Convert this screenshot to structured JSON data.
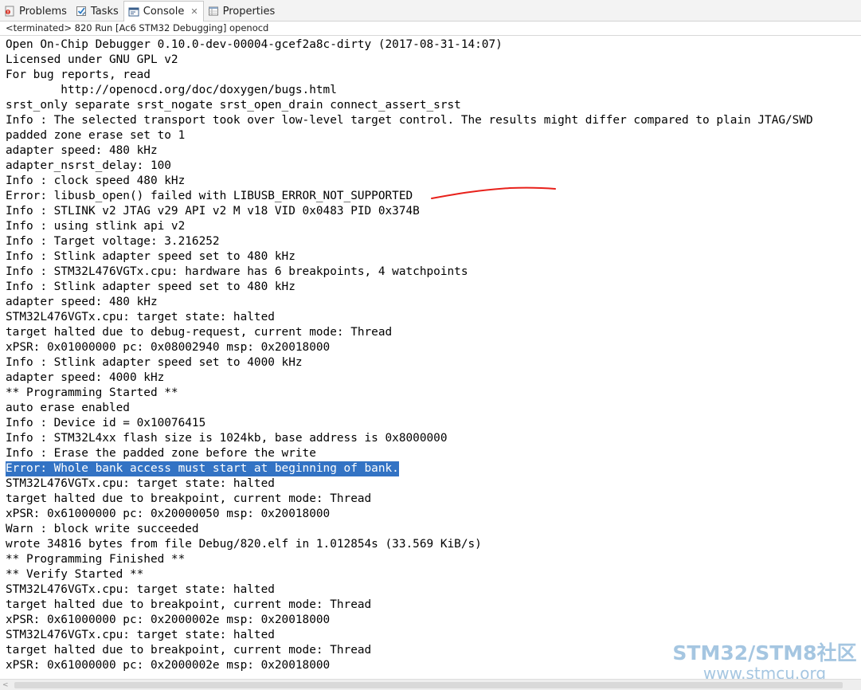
{
  "tabs": [
    {
      "label": "Problems",
      "icon": "problems-icon"
    },
    {
      "label": "Tasks",
      "icon": "tasks-icon"
    },
    {
      "label": "Console",
      "icon": "console-icon",
      "active": true
    },
    {
      "label": "Properties",
      "icon": "properties-icon"
    }
  ],
  "status": "<terminated> 820 Run [Ac6 STM32 Debugging] openocd",
  "console": {
    "lines": [
      "Open On-Chip Debugger 0.10.0-dev-00004-gcef2a8c-dirty (2017-08-31-14:07)",
      "Licensed under GNU GPL v2",
      "For bug reports, read",
      "        http://openocd.org/doc/doxygen/bugs.html",
      "srst_only separate srst_nogate srst_open_drain connect_assert_srst",
      "Info : The selected transport took over low-level target control. The results might differ compared to plain JTAG/SWD",
      "padded zone erase set to 1",
      "adapter speed: 480 kHz",
      "adapter_nsrst_delay: 100",
      "Info : clock speed 480 kHz",
      "Error: libusb_open() failed with LIBUSB_ERROR_NOT_SUPPORTED",
      "Info : STLINK v2 JTAG v29 API v2 M v18 VID 0x0483 PID 0x374B",
      "Info : using stlink api v2",
      "Info : Target voltage: 3.216252",
      "Info : Stlink adapter speed set to 480 kHz",
      "Info : STM32L476VGTx.cpu: hardware has 6 breakpoints, 4 watchpoints",
      "Info : Stlink adapter speed set to 480 kHz",
      "adapter speed: 480 kHz",
      "STM32L476VGTx.cpu: target state: halted",
      "target halted due to debug-request, current mode: Thread",
      "xPSR: 0x01000000 pc: 0x08002940 msp: 0x20018000",
      "Info : Stlink adapter speed set to 4000 kHz",
      "adapter speed: 4000 kHz",
      "** Programming Started **",
      "auto erase enabled",
      "Info : Device id = 0x10076415",
      "Info : STM32L4xx flash size is 1024kb, base address is 0x8000000",
      "Info : Erase the padded zone before the write",
      "Error: Whole bank access must start at beginning of bank.",
      "STM32L476VGTx.cpu: target state: halted",
      "target halted due to breakpoint, current mode: Thread",
      "xPSR: 0x61000000 pc: 0x20000050 msp: 0x20018000",
      "Warn : block write succeeded",
      "wrote 34816 bytes from file Debug/820.elf in 1.012854s (33.569 KiB/s)",
      "** Programming Finished **",
      "** Verify Started **",
      "STM32L476VGTx.cpu: target state: halted",
      "target halted due to breakpoint, current mode: Thread",
      "xPSR: 0x61000000 pc: 0x2000002e msp: 0x20018000",
      "STM32L476VGTx.cpu: target state: halted",
      "target halted due to breakpoint, current mode: Thread",
      "xPSR: 0x61000000 pc: 0x2000002e msp: 0x20018000"
    ],
    "selected_line": 28,
    "underlined_line": 10,
    "underline_color": "#e8211b",
    "selection_color": "#3373c4"
  },
  "watermark": {
    "line1": "STM32/STM8社区",
    "line2": "www.stmcu.org"
  }
}
